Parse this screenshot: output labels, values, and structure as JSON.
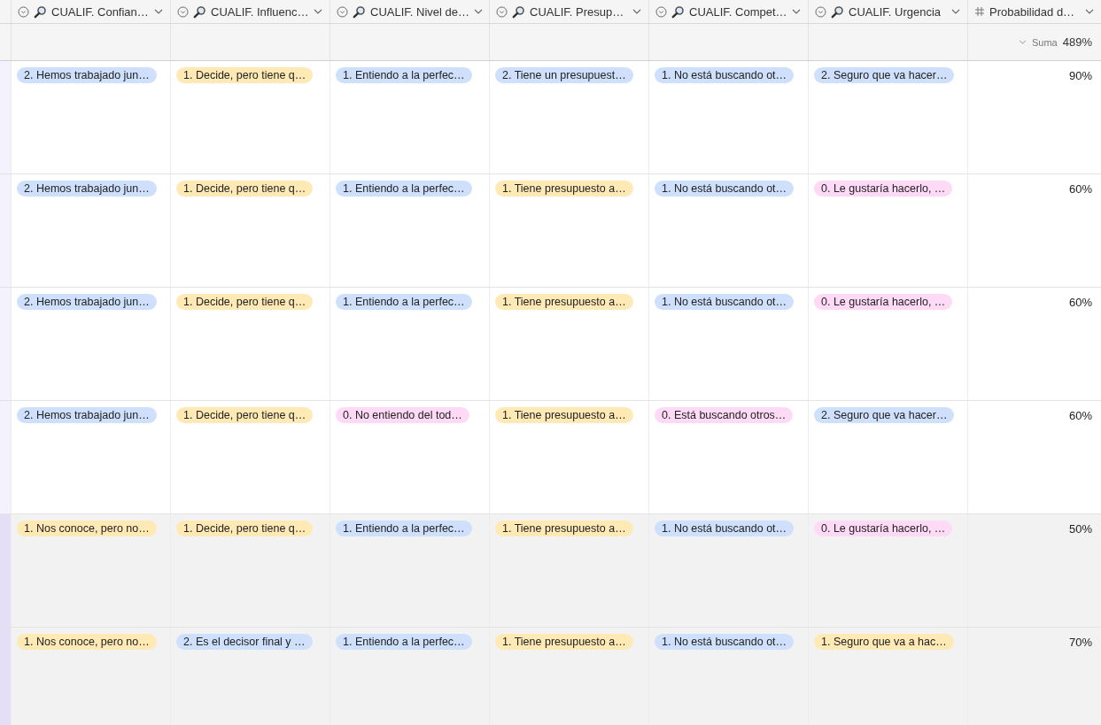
{
  "columns": [
    {
      "label": "CUALIF. Confian…",
      "kind": "select"
    },
    {
      "label": "CUALIF. Influenc…",
      "kind": "select"
    },
    {
      "label": "CUALIF. Nivel de…",
      "kind": "select"
    },
    {
      "label": "CUALIF. Presup…",
      "kind": "select"
    },
    {
      "label": "CUALIF. Compet…",
      "kind": "select"
    },
    {
      "label": "CUALIF. Urgencia",
      "kind": "select"
    },
    {
      "label": "Probabilidad d…",
      "kind": "number"
    }
  ],
  "summary": {
    "label": "Suma",
    "value": "489%"
  },
  "rows": [
    {
      "highlighted": false,
      "tags": [
        {
          "text": "2. Hemos trabajado jun…",
          "color": "#cfe0fc"
        },
        {
          "text": "1. Decide, pero tiene q…",
          "color": "#ffeab6"
        },
        {
          "text": "1. Entiendo a la perfec…",
          "color": "#cfe0fc"
        },
        {
          "text": "2. Tiene un presupuest…",
          "color": "#cfe0fc"
        },
        {
          "text": "1. No está buscando ot…",
          "color": "#cfe0fc"
        },
        {
          "text": "2. Seguro que va hacer…",
          "color": "#cfe0fc"
        }
      ],
      "probability": "90%"
    },
    {
      "highlighted": false,
      "tags": [
        {
          "text": "2. Hemos trabajado jun…",
          "color": "#cfe0fc"
        },
        {
          "text": "1. Decide, pero tiene q…",
          "color": "#ffeab6"
        },
        {
          "text": "1. Entiendo a la perfec…",
          "color": "#cfe0fc"
        },
        {
          "text": "1. Tiene presupuesto a…",
          "color": "#ffeab6"
        },
        {
          "text": "1. No está buscando ot…",
          "color": "#cfe0fc"
        },
        {
          "text": "0. Le gustaría hacerlo, …",
          "color": "#ffdaf6"
        }
      ],
      "probability": "60%"
    },
    {
      "highlighted": false,
      "tags": [
        {
          "text": "2. Hemos trabajado jun…",
          "color": "#cfe0fc"
        },
        {
          "text": "1. Decide, pero tiene q…",
          "color": "#ffeab6"
        },
        {
          "text": "1. Entiendo a la perfec…",
          "color": "#cfe0fc"
        },
        {
          "text": "1. Tiene presupuesto a…",
          "color": "#ffeab6"
        },
        {
          "text": "1. No está buscando ot…",
          "color": "#cfe0fc"
        },
        {
          "text": "0. Le gustaría hacerlo, …",
          "color": "#ffdaf6"
        }
      ],
      "probability": "60%"
    },
    {
      "highlighted": false,
      "tags": [
        {
          "text": "2. Hemos trabajado jun…",
          "color": "#cfe0fc"
        },
        {
          "text": "1. Decide, pero tiene q…",
          "color": "#ffeab6"
        },
        {
          "text": "0. No entiendo del tod…",
          "color": "#ffdaf6"
        },
        {
          "text": "1. Tiene presupuesto a…",
          "color": "#ffeab6"
        },
        {
          "text": "0. Está buscando otros…",
          "color": "#ffdaf6"
        },
        {
          "text": "2. Seguro que va hacer…",
          "color": "#cfe0fc"
        }
      ],
      "probability": "60%"
    },
    {
      "highlighted": true,
      "tags": [
        {
          "text": "1. Nos conoce, pero no…",
          "color": "#ffeab6"
        },
        {
          "text": "1. Decide, pero tiene q…",
          "color": "#ffeab6"
        },
        {
          "text": "1. Entiendo a la perfec…",
          "color": "#cfe0fc"
        },
        {
          "text": "1. Tiene presupuesto a…",
          "color": "#ffeab6"
        },
        {
          "text": "1. No está buscando ot…",
          "color": "#cfe0fc"
        },
        {
          "text": "0. Le gustaría hacerlo, …",
          "color": "#ffdaf6"
        }
      ],
      "probability": "50%"
    },
    {
      "highlighted": true,
      "tags": [
        {
          "text": "1. Nos conoce, pero no…",
          "color": "#ffeab6"
        },
        {
          "text": "2. Es el decisor final y …",
          "color": "#cfe0fc"
        },
        {
          "text": "1. Entiendo a la perfec…",
          "color": "#cfe0fc"
        },
        {
          "text": "1. Tiene presupuesto a…",
          "color": "#ffeab6"
        },
        {
          "text": "1. No está buscando ot…",
          "color": "#cfe0fc"
        },
        {
          "text": "1. Seguro que va a hac…",
          "color": "#ffeab6"
        }
      ],
      "probability": "70%"
    }
  ]
}
